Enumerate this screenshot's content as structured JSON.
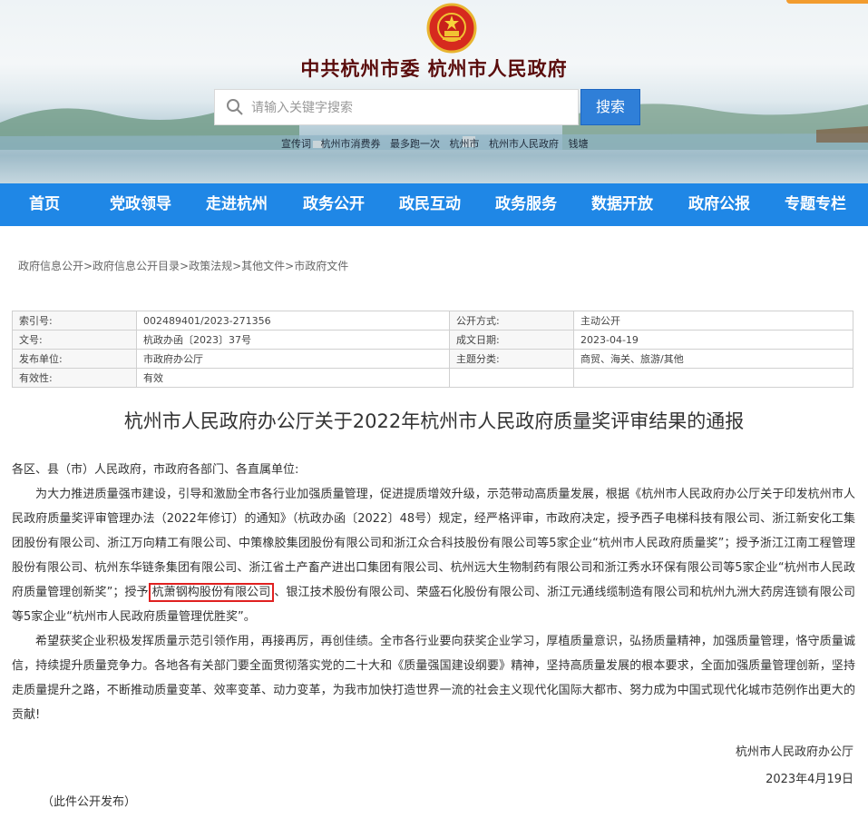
{
  "header": {
    "site_title": "中共杭州市委   杭州市人民政府",
    "search": {
      "placeholder": "请输入关键字搜索",
      "button_label": "搜索"
    },
    "hot_words": [
      "宣传词",
      "杭州市消费券",
      "最多跑一次",
      "杭州市",
      "杭州市人民政府",
      "钱塘"
    ]
  },
  "nav": [
    "首页",
    "党政领导",
    "走进杭州",
    "政务公开",
    "政民互动",
    "政务服务",
    "数据开放",
    "政府公报",
    "专题专栏"
  ],
  "breadcrumb": "政府信息公开>政府信息公开目录>政策法规>其他文件>市政府文件",
  "meta": {
    "rows": [
      [
        "索引号:",
        "002489401/2023-271356",
        "公开方式:",
        "主动公开"
      ],
      [
        "文号:",
        "杭政办函〔2023〕37号",
        "成文日期:",
        "2023-04-19"
      ],
      [
        "发布单位:",
        "市政府办公厅",
        "主题分类:",
        "商贸、海关、旅游/其他"
      ],
      [
        "有效性:",
        "有效",
        "",
        ""
      ]
    ]
  },
  "document": {
    "title": "杭州市人民政府办公厅关于2022年杭州市人民政府质量奖评审结果的通报",
    "salutation": "各区、县（市）人民政府，市政府各部门、各直属单位:",
    "para1_before": "为大力推进质量强市建设，引导和激励全市各行业加强质量管理，促进提质增效升级，示范带动高质量发展，根据《杭州市人民政府办公厅关于印发杭州市人民政府质量奖评审管理办法（2022年修订）的通知》（杭政办函〔2022〕48号）规定，经严格评审，市政府决定，授予西子电梯科技有限公司、浙江新安化工集团股份有限公司、浙江万向精工有限公司、中策橡胶集团股份有限公司和浙江众合科技股份有限公司等5家企业“杭州市人民政府质量奖”；授予浙江江南工程管理股份有限公司、杭州东华链条集团有限公司、浙江省土产畜产进出口集团有限公司、杭州远大生物制药有限公司和浙江秀水环保有限公司等5家企业“杭州市人民政府质量管理创新奖”；授予",
    "para1_highlight": "杭萧钢构股份有限公司",
    "para1_after": "、银江技术股份有限公司、荣盛石化股份有限公司、浙江元通线缆制造有限公司和杭州九洲大药房连锁有限公司等5家企业“杭州市人民政府质量管理优胜奖”。",
    "para2": "希望获奖企业积极发挥质量示范引领作用，再接再厉，再创佳绩。全市各行业要向获奖企业学习，厚植质量意识，弘扬质量精神，加强质量管理，恪守质量诚信，持续提升质量竞争力。各地各有关部门要全面贯彻落实党的二十大和《质量强国建设纲要》精神，坚持高质量发展的根本要求，全面加强质量管理创新，坚持走质量提升之路，不断推动质量变革、效率变革、动力变革，为我市加快打造世界一流的社会主义现代化国际大都市、努力成为中国式现代化城市范例作出更大的贡献!",
    "signature": "杭州市人民政府办公厅",
    "date": "2023年4月19日",
    "publish_note": "（此件公开发布）"
  },
  "colors": {
    "nav_bg": "#1f87e6",
    "search_button": "#2f7fd8",
    "title_color": "#5a0c0c",
    "highlight_border": "#e02020"
  }
}
